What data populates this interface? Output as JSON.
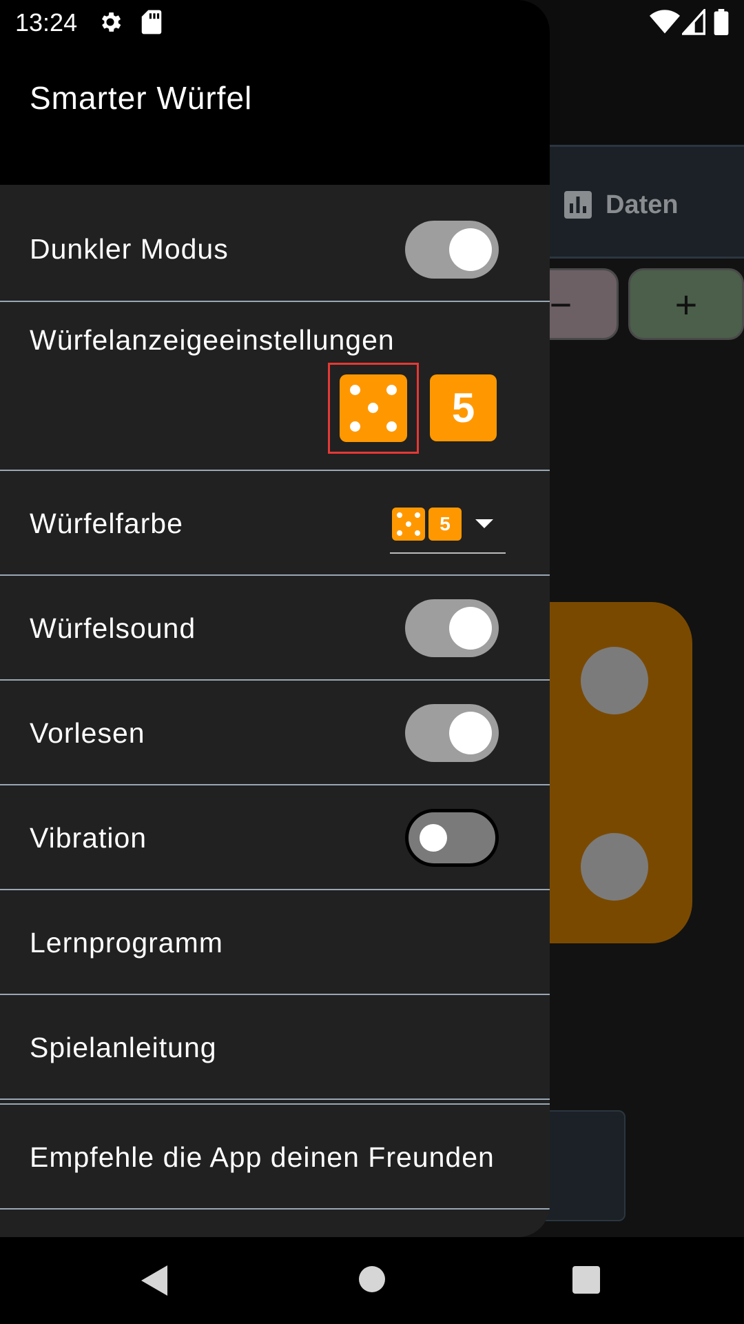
{
  "status_bar": {
    "time": "13:24"
  },
  "app": {
    "title": "Smarter Würfel"
  },
  "background": {
    "tab_daten_label": "Daten",
    "minus_label": "−",
    "plus_label": "+"
  },
  "settings": {
    "dark_mode": {
      "label": "Dunkler Modus",
      "enabled": true
    },
    "dice_display": {
      "label": "Würfelanzeigeeinstellungen",
      "pips_value": 5,
      "number_label": "5",
      "selected": "pips"
    },
    "dice_color": {
      "label": "Würfelfarbe",
      "selected_color": "#ff9800",
      "number_label": "5"
    },
    "dice_sound": {
      "label": "Würfelsound",
      "enabled": true
    },
    "read_aloud": {
      "label": "Vorlesen",
      "enabled": true
    },
    "vibration": {
      "label": "Vibration",
      "enabled": false
    }
  },
  "menu": {
    "tutorial": "Lernprogramm",
    "instructions": "Spielanleitung",
    "recommend": "Empfehle die App deinen Freunden"
  },
  "colors": {
    "accent": "#ff9800",
    "drawer_bg": "#212121",
    "divider": "#9aa8b5",
    "selection_frame": "#e53935"
  }
}
